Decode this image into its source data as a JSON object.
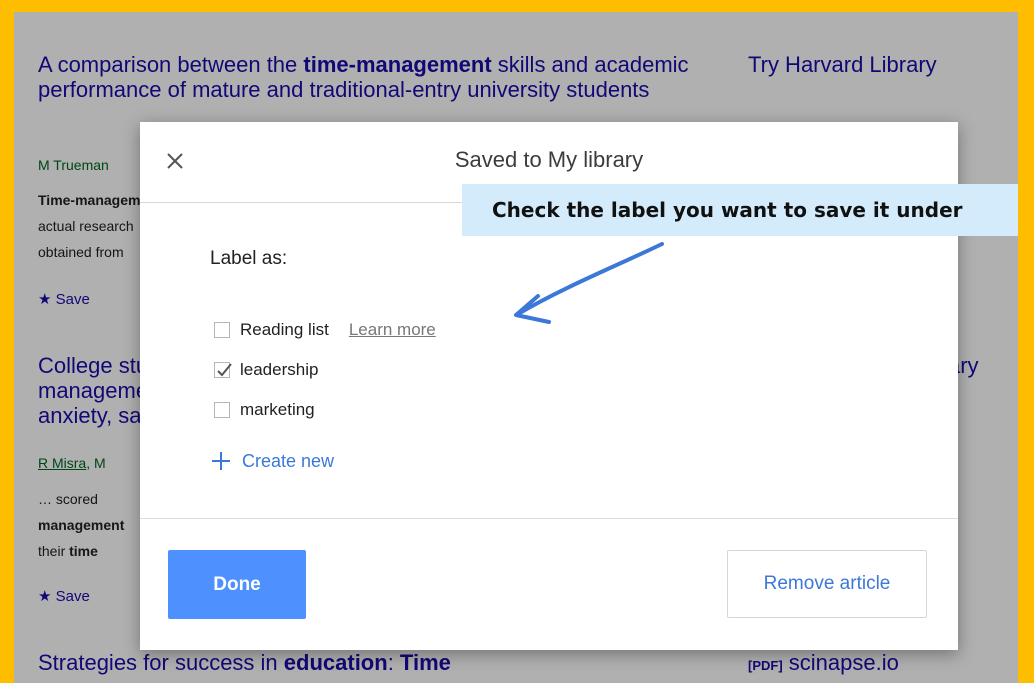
{
  "results": [
    {
      "title_parts": [
        "A comparison between the ",
        "time-management",
        " skills and academic performance of mature and traditional-entry university students"
      ],
      "authors": "M Trueman",
      "snippet_bold": "Time-management",
      "snippet_line2": "actual research",
      "snippet_line3": "obtained from",
      "save": "Save"
    },
    {
      "title_lines": [
        "College students' time management: their anxiety, satisfaction"
      ],
      "authors_first": "R Misra",
      "authors_rest": ", M",
      "snippet_line1": "… scored",
      "snippet_bold": "management",
      "snippet_line3_pre": "their ",
      "snippet_line3_bold": "time",
      "save": "Save"
    },
    {
      "title_parts": [
        "Strategies for success in ",
        "education",
        ": ",
        "Time"
      ]
    }
  ],
  "sidebar": {
    "link1": "Try Harvard Library",
    "link2": "ary",
    "pdf_tag": "[PDF]",
    "pdf_source": "scinapse.io"
  },
  "dialog": {
    "title": "Saved to My library",
    "label_as": "Label as:",
    "labels": [
      {
        "name": "Reading list",
        "checked": false,
        "link": "Learn more"
      },
      {
        "name": "leadership",
        "checked": true
      },
      {
        "name": "marketing",
        "checked": false
      }
    ],
    "create_new": "Create new",
    "done": "Done",
    "remove": "Remove article"
  },
  "callout": {
    "text": "Check the label you want to save it under"
  },
  "colors": {
    "frame": "#ffbd00",
    "link": "#1a0dab",
    "accent_blue": "#4d90fe",
    "callout_bg": "#d3ebfa",
    "arrow": "#3c78d8"
  }
}
